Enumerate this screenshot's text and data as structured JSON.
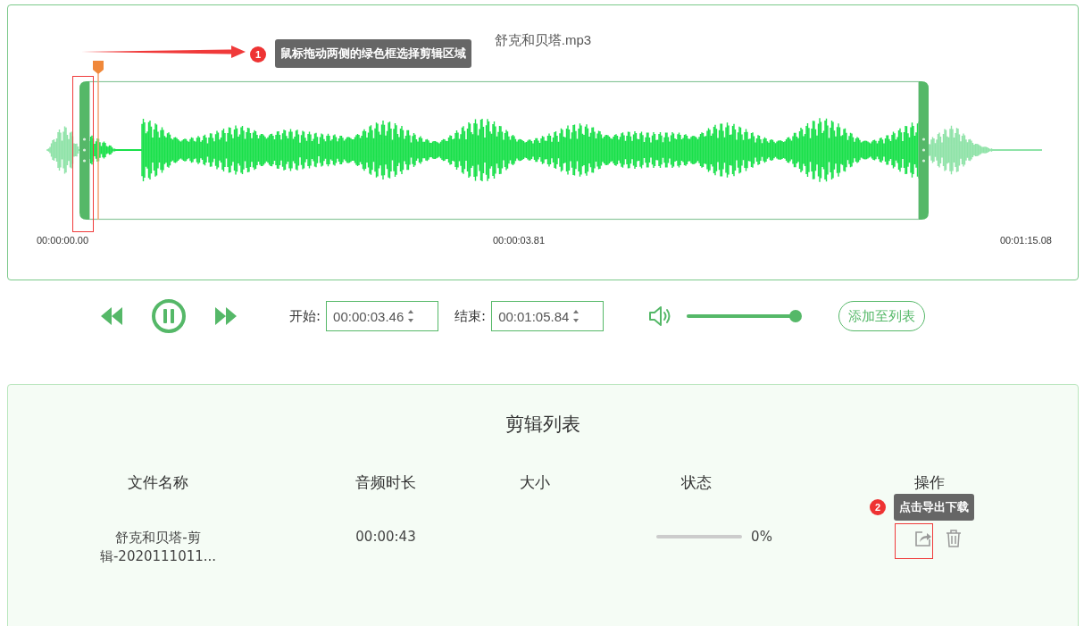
{
  "editor": {
    "file_title": "舒克和贝塔.mp3",
    "time_start": "00:00:00.00",
    "time_mid": "00:00:03.81",
    "time_end": "00:01:15.08"
  },
  "annotations": [
    {
      "number": "1",
      "text": "鼠标拖动两侧的绿色框选择剪辑区域"
    },
    {
      "number": "2",
      "text": "点击导出下载"
    }
  ],
  "controls": {
    "start_label": "开始:",
    "start_value": "00:00:03.46",
    "end_label": "结束:",
    "end_value": "00:01:05.84",
    "volume": {
      "level": 1
    },
    "add_button": "添加至列表"
  },
  "clip_list": {
    "title": "剪辑列表",
    "columns": [
      "文件名称",
      "音频时长",
      "大小",
      "状态",
      "操作"
    ],
    "rows": [
      {
        "name": [
          "舒克和贝塔-剪",
          "辑-2020111011..."
        ],
        "duration": "00:00:43",
        "progress": {
          "level": 0
        },
        "reading": "0%"
      }
    ]
  }
}
